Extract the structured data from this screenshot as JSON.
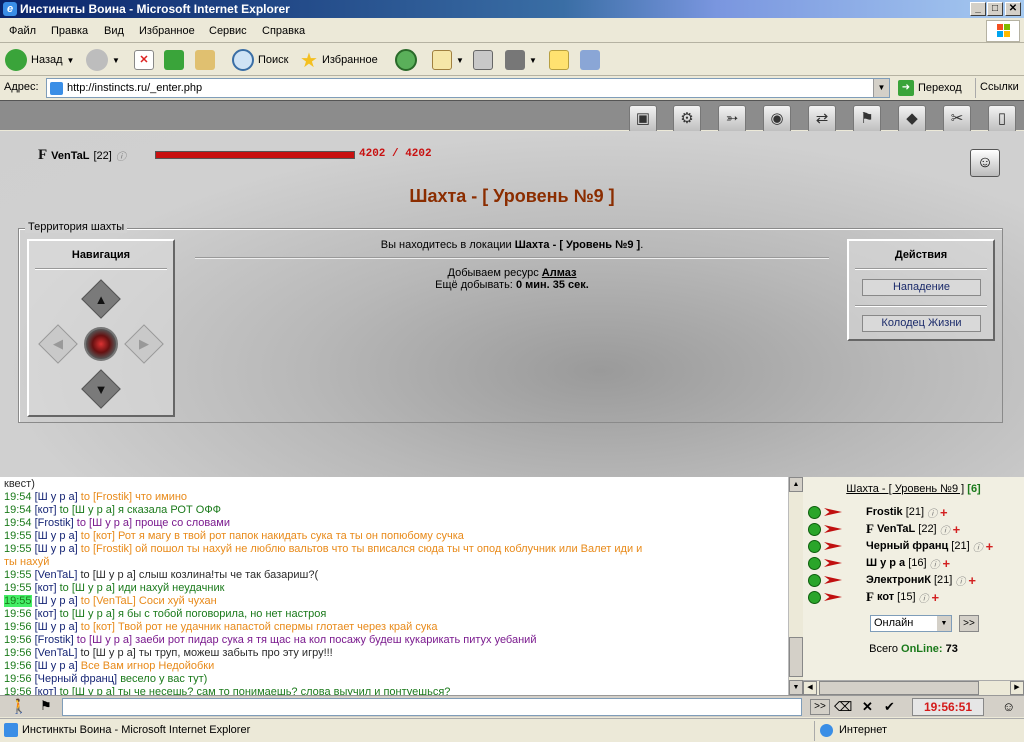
{
  "window": {
    "title": "Инстинкты Воина - Microsoft Internet Explorer",
    "min": "_",
    "max": "□",
    "close": "✕"
  },
  "menu": [
    "Файл",
    "Правка",
    "Вид",
    "Избранное",
    "Сервис",
    "Справка"
  ],
  "toolbar": {
    "back": "Назад",
    "search": "Поиск",
    "favorites": "Избранное"
  },
  "address": {
    "label": "Адрес:",
    "url": "http://instincts.ru/_enter.php",
    "go": "Переход",
    "links": "Ссылки"
  },
  "game": {
    "clan_icon": "F",
    "player": "VenTaL",
    "level": "[22]",
    "hp": "4202 / 4202",
    "hp_fraction": 1.0,
    "location_title": "Шахта - [ Уровень №9 ]",
    "territory_label": "Территория шахты",
    "nav_title": "Навигация",
    "actions_title": "Действия",
    "actions": [
      "Нападение",
      "Колодец Жизни"
    ],
    "location_prefix": "Вы находитесь в локации",
    "location_name": "Шахта - [ Уровень №9 ]",
    "mining_prefix": "Добываем ресурс",
    "resource": "Алмаз",
    "remaining_prefix": "Ещё добывать:",
    "remaining": "0 мин. 35 сек."
  },
  "chat": [
    {
      "t": "",
      "head": "квест)",
      "msg": "",
      "cls": "dk"
    },
    {
      "t": "19:54",
      "head": "[Ш у р а]",
      "to": "to [Frostik]",
      "msg": "что имино",
      "cls": "o"
    },
    {
      "t": "19:54",
      "head": "[кот]",
      "to": "to [Ш у р а]",
      "msg": "я сказала РОТ ОФФ",
      "cls": "g"
    },
    {
      "t": "19:54",
      "head": "[Frostik]",
      "to": "to [Ш у р а]",
      "msg": "проще со словами",
      "cls": "pu"
    },
    {
      "t": "19:55",
      "head": "[Ш у р а]",
      "to": "to [кот]",
      "msg": "Рот я магу в твой рот папок накидать сука та ты он попюбому сучка",
      "cls": "o"
    },
    {
      "t": "19:55",
      "head": "[Ш у р а]",
      "to": "to [Frostik]",
      "msg": "ой пошол ты нахуй не люблю вальтов что ты вписался сюда ты чт опод коблучник или Валет иди и",
      "cls": "o"
    },
    {
      "t": "",
      "head": "ты нахуй",
      "msg": "",
      "cls": "o"
    },
    {
      "t": "19:55",
      "head": "[VenTaL]",
      "to": "to [Ш у р а]",
      "msg": "слыш козлина!ты че так базариш?(",
      "cls": "dk"
    },
    {
      "t": "19:55",
      "head": "[кот]",
      "to": "to [Ш у р а]",
      "msg": "иди нахуй неудачник",
      "cls": "g"
    },
    {
      "t": "19:55",
      "head": "[Ш у р а]",
      "to": "to",
      "msg": "[VenTaL] Соси хуй чухан",
      "cls": "o"
    },
    {
      "t": "19:56",
      "head": "[кот]",
      "to": "to [Ш у р а]",
      "msg": "я бы с тобой поговорила, но нет настроя",
      "cls": "g"
    },
    {
      "t": "19:56",
      "head": "[Ш у р а]",
      "to": "to [кот]",
      "msg": "Твой рот не удачник напастой спермы глотает через край сука",
      "cls": "o"
    },
    {
      "t": "19:56",
      "head": "[Frostik]",
      "to": "to [Ш у р а]",
      "msg": "заеби рот пидар сука я тя щас на кол посажу будеш кукарикать питух уебаний",
      "cls": "pu"
    },
    {
      "t": "19:56",
      "head": "[VenTaL]",
      "to": "to [Ш у р а]",
      "msg": "ты труп, можеш забыть про эту игру!!!",
      "cls": "dk"
    },
    {
      "t": "19:56",
      "head": "[Ш у р а]",
      "to": "",
      "msg": "Все Вам игнор Недойобки",
      "cls": "o"
    },
    {
      "t": "19:56",
      "head": "[Черный франц]",
      "to": "",
      "msg": "весело у вас тут)",
      "cls": "g"
    },
    {
      "t": "19:56",
      "head": "[кот]",
      "to": "to [Ш у р а]",
      "msg": "ты че несешь? сам то понимаешь? слова выучил и понтуешься?",
      "cls": "g"
    }
  ],
  "users": {
    "location": "Шахта - [ Уровень №9 ]",
    "count": "[6]",
    "list": [
      {
        "name": "Frostik",
        "level": "[21]",
        "prefix": ""
      },
      {
        "name": "VenTaL",
        "level": "[22]",
        "prefix": "F"
      },
      {
        "name": "Черный франц",
        "level": "[21]",
        "prefix": ""
      },
      {
        "name": "Ш у р а",
        "level": "[16]",
        "prefix": ""
      },
      {
        "name": "ЭлектрониК",
        "level": "[21]",
        "prefix": ""
      },
      {
        "name": "кот",
        "level": "[15]",
        "prefix": "F"
      }
    ],
    "filter": "Онлайн",
    "total_label": "Всего",
    "online_label": "OnLine:",
    "total": "73"
  },
  "bottom": {
    "clock": "19:56:51",
    "go": ">>"
  },
  "status": {
    "zone": "Интернет"
  }
}
